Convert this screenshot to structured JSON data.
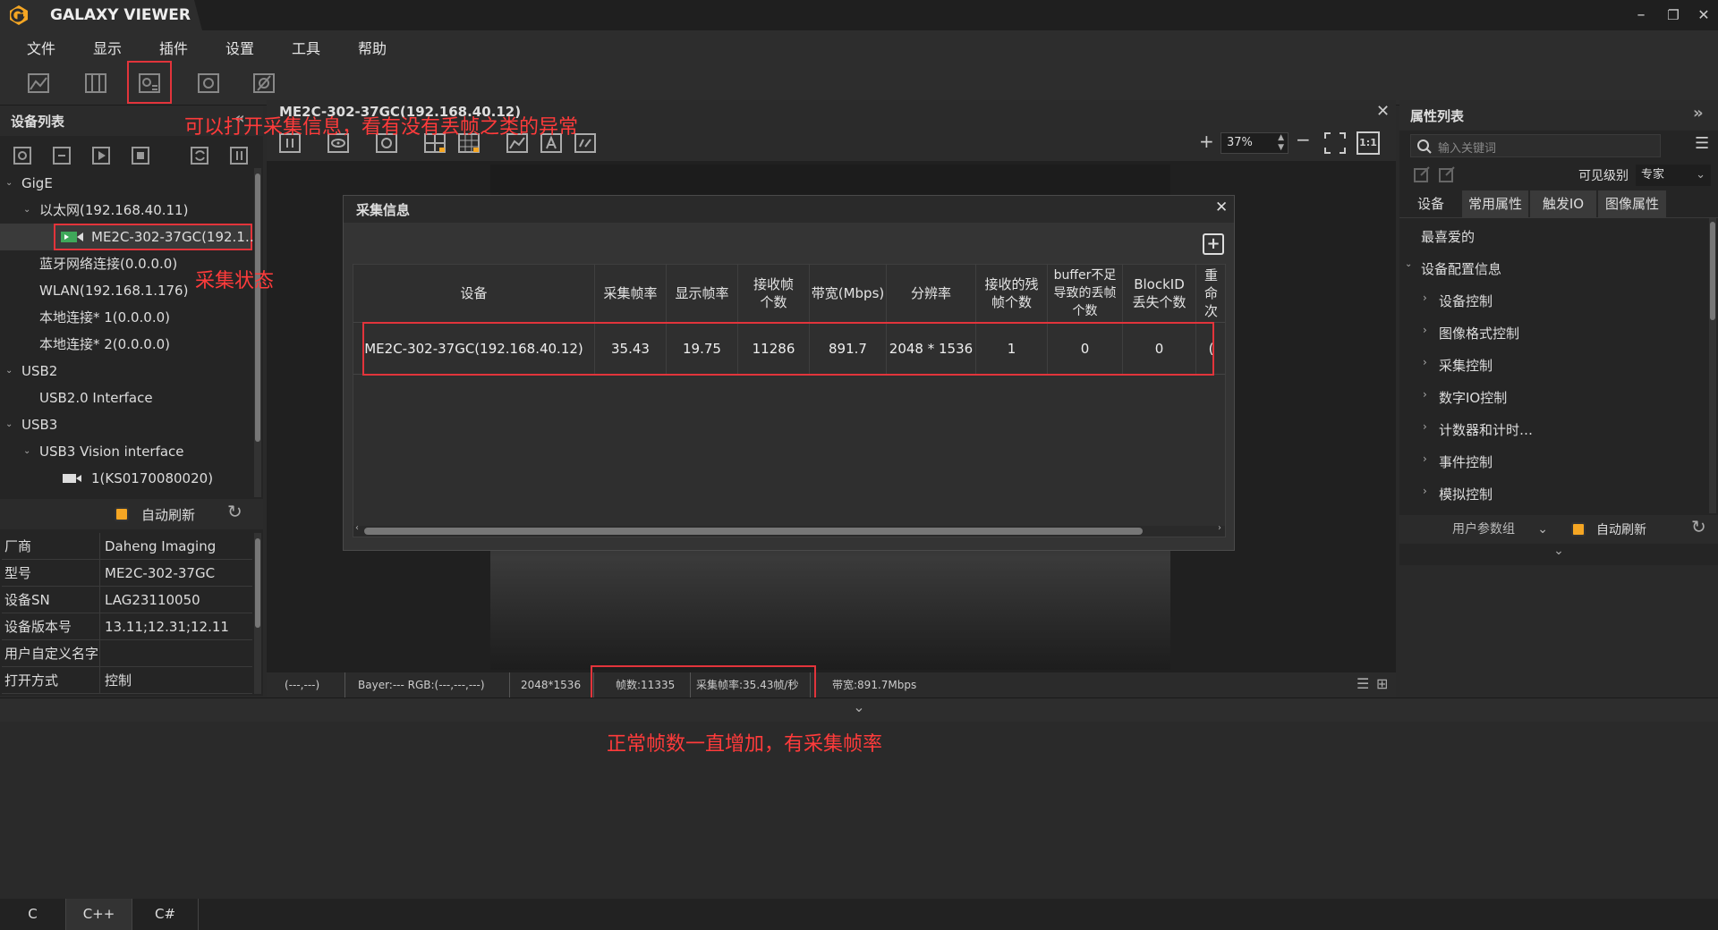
{
  "app": {
    "title": "GALAXY VIEWER",
    "win_min": "–",
    "win_restore": "❐",
    "win_close": "✕"
  },
  "menu": [
    "文件",
    "显示",
    "插件",
    "设置",
    "工具",
    "帮助"
  ],
  "left_panel": {
    "title": "设备列表",
    "collapse": "«",
    "tree": [
      {
        "label": "GigE",
        "arrow": "⌄"
      },
      {
        "label": "以太网(192.168.40.11)",
        "arrow": "⌄"
      },
      {
        "label": "ME2C-302-37GC(192.1…",
        "arrow": ""
      },
      {
        "label": "蓝牙网络连接(0.0.0.0)",
        "arrow": ""
      },
      {
        "label": "WLAN(192.168.1.176)",
        "arrow": ""
      },
      {
        "label": "本地连接* 1(0.0.0.0)",
        "arrow": ""
      },
      {
        "label": "本地连接* 2(0.0.0.0)",
        "arrow": ""
      },
      {
        "label": "USB2",
        "arrow": "⌄"
      },
      {
        "label": "USB2.0 Interface",
        "arrow": ""
      },
      {
        "label": "USB3",
        "arrow": "⌄"
      },
      {
        "label": "USB3 Vision interface",
        "arrow": "⌄"
      },
      {
        "label": "1(KS0170080020)",
        "arrow": ""
      }
    ],
    "auto_refresh": "自动刷新",
    "props": [
      {
        "k": "厂商",
        "v": "Daheng Imaging"
      },
      {
        "k": "型号",
        "v": "ME2C-302-37GC"
      },
      {
        "k": "设备SN",
        "v": "LAG23110050"
      },
      {
        "k": "设备版本号",
        "v": "13.11;12.31;12.11"
      },
      {
        "k": "用户自定义名字",
        "v": ""
      },
      {
        "k": "打开方式",
        "v": "控制"
      }
    ]
  },
  "center": {
    "tab_title": "ME2C-302-37GC(192.168.40.12)",
    "zoom": "37%",
    "zoom_in": "+",
    "zoom_out": "−",
    "fit": "1:1"
  },
  "dialog": {
    "title": "采集信息",
    "add": "+",
    "headers": [
      "设备",
      "采集帧率",
      "显示帧率",
      "接收帧个数",
      "带宽(Mbps)",
      "分辨率",
      "接收的残帧个数",
      "buffer不足导致的丢帧个数",
      "BlockID丢失个数",
      "重命次"
    ],
    "row": [
      "ME2C-302-37GC(192.168.40.12)",
      "35.43",
      "19.75",
      "11286",
      "891.7",
      "2048 * 1536",
      "1",
      "0",
      "0",
      "("
    ]
  },
  "statusbar": {
    "pos": "(---,---)",
    "pixel": "Bayer:---  RGB:(---,---,---)",
    "resolution": "2048*1536",
    "frames": "帧数:11335",
    "fps": "采集帧率:35.43帧/秒",
    "bandwidth": "带宽:891.7Mbps"
  },
  "right_panel": {
    "title": "属性列表",
    "expand": "»",
    "search_placeholder": "输入关键词",
    "visibility_label": "可见级别",
    "visibility_value": "专家",
    "tabs": [
      "设备",
      "常用属性",
      "触发IO",
      "图像属性"
    ],
    "favorites": "最喜爱的",
    "group": "设备配置信息",
    "items": [
      "设备控制",
      "图像格式控制",
      "采集控制",
      "数字IO控制",
      "计数器和计时…",
      "事件控制",
      "模拟控制"
    ],
    "param_group": "用户参数组",
    "auto_refresh": "自动刷新"
  },
  "annotations": {
    "top": "可以打开采集信息，看有没有丢帧之类的异常",
    "left": "采集状态",
    "bottom": "正常帧数一直增加，有采集帧率"
  },
  "lang_tabs": [
    "C",
    "C++",
    "C#"
  ],
  "colors": {
    "accent": "#f5a623",
    "highlight": "#e2343b",
    "annotation": "#ff3b3b"
  }
}
